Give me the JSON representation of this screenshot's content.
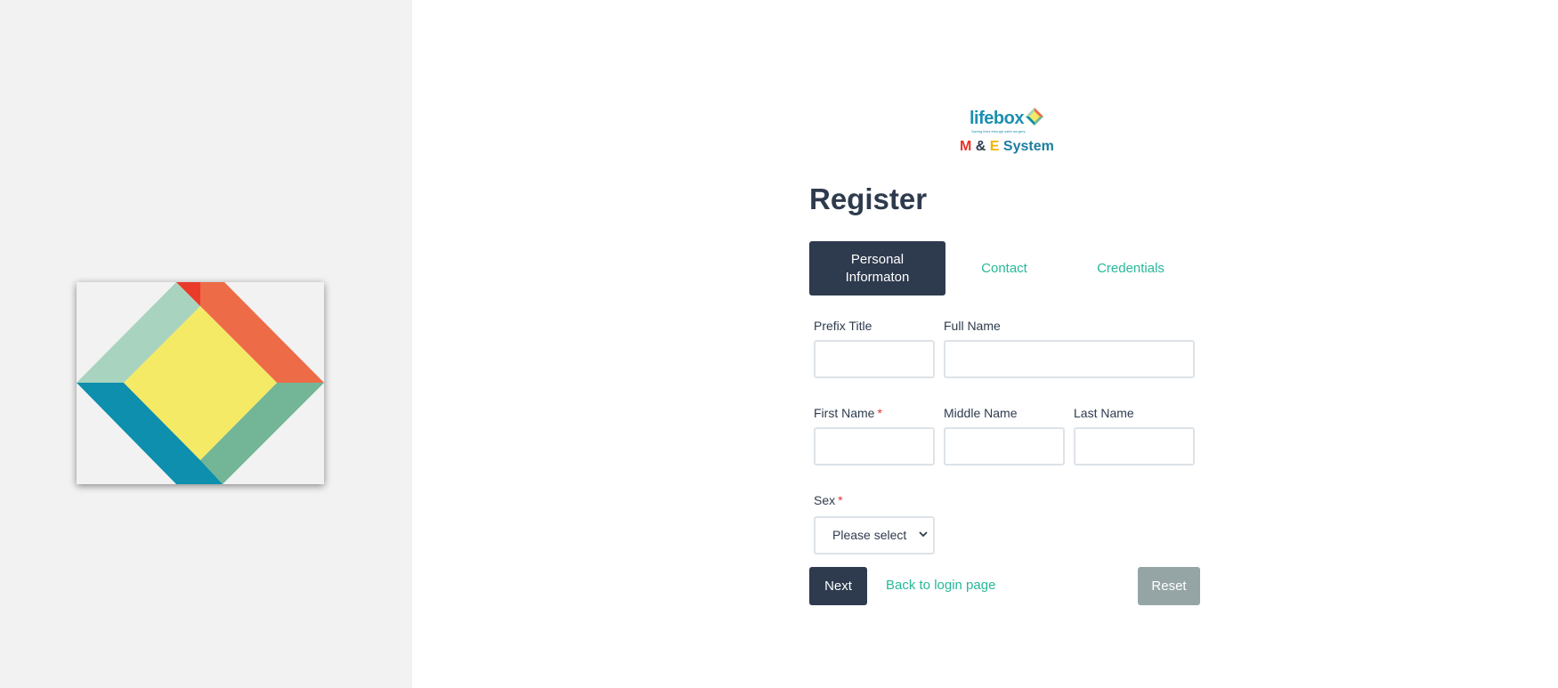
{
  "brand": {
    "logo_text": "lifebox",
    "tagline": "Saving lives through safer surgery",
    "system_m": "M",
    "system_amp": "&",
    "system_e": "E",
    "system_word": "System"
  },
  "page": {
    "title": "Register"
  },
  "tabs": [
    {
      "label": "Personal Informaton",
      "active": true
    },
    {
      "label": "Contact",
      "active": false
    },
    {
      "label": "Credentials",
      "active": false
    }
  ],
  "form": {
    "prefix_title": {
      "label": "Prefix Title",
      "value": ""
    },
    "full_name": {
      "label": "Full Name",
      "value": ""
    },
    "first_name": {
      "label": "First Name",
      "required_mark": "*",
      "value": ""
    },
    "middle_name": {
      "label": "Middle Name",
      "value": ""
    },
    "last_name": {
      "label": "Last Name",
      "value": ""
    },
    "sex": {
      "label": "Sex",
      "required_mark": "*",
      "selected": "Please select"
    }
  },
  "actions": {
    "next_label": "Next",
    "back_label": "Back to login page",
    "reset_label": "Reset"
  },
  "colors": {
    "navy": "#2e3b4e",
    "teal_link": "#26b999",
    "reset_gray": "#95a5a6",
    "required_red": "#e63329"
  }
}
